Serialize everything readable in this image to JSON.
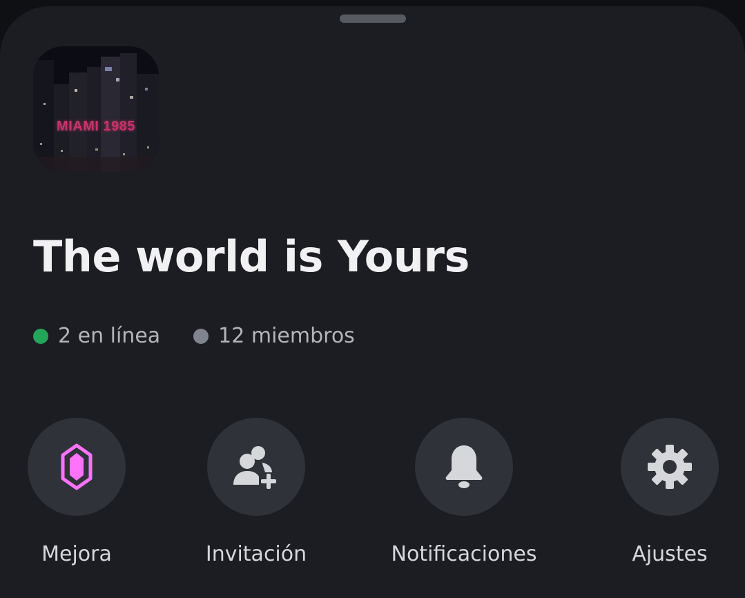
{
  "server": {
    "name": "The world is Yours",
    "icon_text": "MIAMI 1985",
    "online_label": "2 en línea",
    "members_label": "12 miembros"
  },
  "actions": [
    {
      "label": "Mejora",
      "icon": "boost-gem-icon"
    },
    {
      "label": "Invitación",
      "icon": "add-person-icon"
    },
    {
      "label": "Notificaciones",
      "icon": "bell-icon"
    },
    {
      "label": "Ajustes",
      "icon": "gear-icon"
    }
  ],
  "colors": {
    "background": "#1c1d22",
    "button_bg": "#30323a",
    "online": "#23a55a",
    "offline": "#80848e",
    "boost": "#ff73fa",
    "text_primary": "#f1f1f3",
    "text_secondary": "#b3b5bb"
  }
}
